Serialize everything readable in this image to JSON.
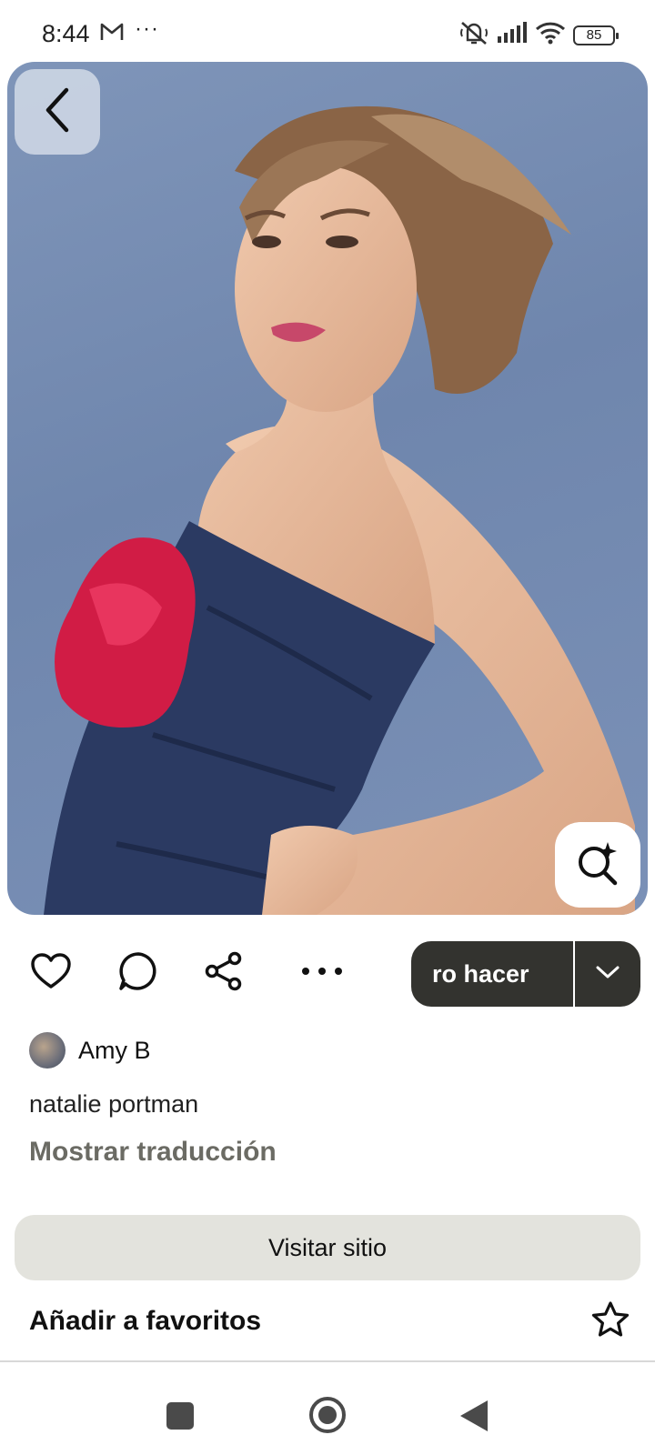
{
  "status_bar": {
    "time": "8:44",
    "mail_icon": "gmail-icon",
    "more": "···",
    "battery": "85"
  },
  "photo": {
    "description_icon": "photo",
    "back_icon": "chevron-left-icon",
    "visual_search_icon": "visual-search-icon"
  },
  "actions": {
    "like_icon": "heart-icon",
    "comment_icon": "comment-icon",
    "share_icon": "share-icon",
    "more_icon": "more-icon",
    "save_label": "ro hacer",
    "dropdown_icon": "chevron-down-icon"
  },
  "pin": {
    "author": "Amy B",
    "description": "natalie portman",
    "translate": "Mostrar traducción",
    "visit": "Visitar sitio",
    "favorite": "Añadir a favoritos"
  },
  "colors": {
    "save_bg": "#33332f",
    "visit_bg": "#e3e3dd",
    "translate_text": "#6b6b64",
    "photo_bg": "#7389b0"
  }
}
